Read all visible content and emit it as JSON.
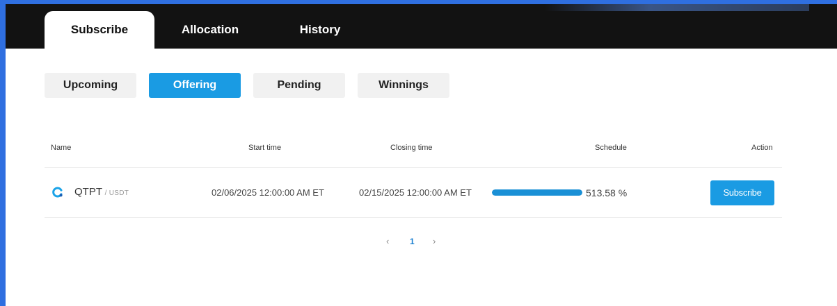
{
  "main_tabs": [
    {
      "label": "Subscribe",
      "active": true
    },
    {
      "label": "Allocation",
      "active": false
    },
    {
      "label": "History",
      "active": false
    }
  ],
  "sub_tabs": [
    {
      "label": "Upcoming",
      "active": false
    },
    {
      "label": "Offering",
      "active": true
    },
    {
      "label": "Pending",
      "active": false
    },
    {
      "label": "Winnings",
      "active": false
    }
  ],
  "table": {
    "columns": [
      "Name",
      "Start time",
      "Closing time",
      "Schedule",
      "Action"
    ],
    "rows": [
      {
        "base": "QTPT",
        "quote": "/ USDT",
        "start_time": "02/06/2025 12:00:00 AM ET",
        "closing_time": "02/15/2025 12:00:00 AM ET",
        "schedule_text": "513.58 %",
        "progress_fraction": 1.0,
        "action_label": "Subscribe"
      }
    ]
  },
  "pagination": {
    "prev_icon": "chevron-left-icon",
    "next_icon": "chevron-right-icon",
    "current_page": "1"
  },
  "colors": {
    "accent": "#1a9be3",
    "header_bg": "#121212",
    "page_frame": "#2f6fe0"
  }
}
